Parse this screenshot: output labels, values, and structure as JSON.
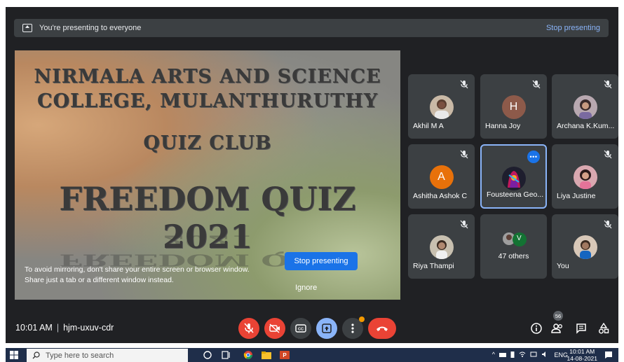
{
  "banner": {
    "message": "You're presenting to everyone",
    "stop_link": "Stop presenting"
  },
  "slide": {
    "line1": "NIRMALA ARTS AND SCIENCE",
    "line2": "COLLEGE, MULANTHURUTHY",
    "line3": "QUIZ CLUB",
    "line4": "FREEDOM QUIZ 2021",
    "warning_line1": "To avoid mirroring, don't share your entire screen or browser window.",
    "warning_line2": "Share just a tab or a different window instead.",
    "stop_button": "Stop presenting",
    "ignore_button": "Ignore"
  },
  "participants": [
    {
      "name": "Akhil M A",
      "muted": true,
      "avatar": "photo",
      "avatar_color": "#c9b9a6"
    },
    {
      "name": "Hanna Joy",
      "muted": true,
      "avatar": "H",
      "avatar_color": "#8d5a4a"
    },
    {
      "name": "Archana K.Kum...",
      "muted": true,
      "avatar": "photo",
      "avatar_color": "#b8a8b0"
    },
    {
      "name": "Ashitha Ashok C",
      "muted": true,
      "avatar": "A",
      "avatar_color": "#e8710a"
    },
    {
      "name": "Fousteena Geo...",
      "muted": false,
      "active": true,
      "avatar": "photo",
      "avatar_color": "#5c3b78"
    },
    {
      "name": "Liya Justine",
      "muted": true,
      "avatar": "photo",
      "avatar_color": "#d9a8b0"
    },
    {
      "name": "Riya Thampi",
      "muted": true,
      "avatar": "photo",
      "avatar_color": "#c8c0b0"
    },
    {
      "name": "47 others",
      "muted": false,
      "avatar": "V",
      "avatar_color": "#137333"
    },
    {
      "name": "You",
      "muted": true,
      "avatar": "photo",
      "avatar_color": "#d8c8b8"
    }
  ],
  "tile_more_label": "•••",
  "meeting": {
    "time": "10:01 AM",
    "code": "hjm-uxuv-cdr",
    "people_count": "56"
  },
  "controls": [
    {
      "name": "mic-off",
      "style": "red"
    },
    {
      "name": "camera-off",
      "style": "red"
    },
    {
      "name": "captions",
      "style": "grey"
    },
    {
      "name": "present-now",
      "style": "blue"
    },
    {
      "name": "more-options",
      "style": "grey"
    },
    {
      "name": "leave-call",
      "style": "hang"
    }
  ],
  "taskbar": {
    "search_placeholder": "Type here to search",
    "language": "ENG",
    "time": "10:01 AM",
    "date": "14-08-2021"
  },
  "colors": {
    "meet_bg": "#202124",
    "tile_bg": "#3c4043",
    "accent_blue": "#1a73e8",
    "danger_red": "#ea4335",
    "link_blue": "#8ab4f8"
  }
}
